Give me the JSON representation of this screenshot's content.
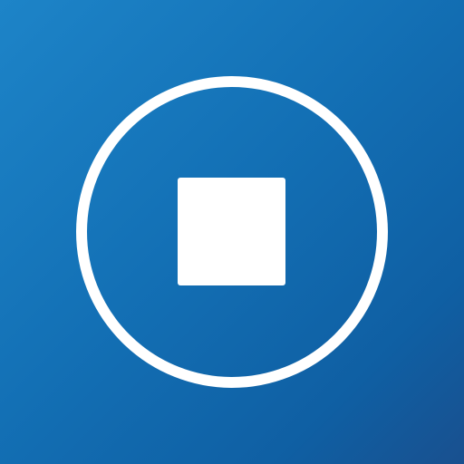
{
  "app": {
    "title": ""
  },
  "colors": {
    "background_start": "#1d84c8",
    "background_end": "#19508f",
    "icon": "#ffffff"
  },
  "icons": {
    "primary": "stop-circle-icon",
    "inner": "stop-square-icon"
  },
  "controls": {
    "stop_label": ""
  }
}
